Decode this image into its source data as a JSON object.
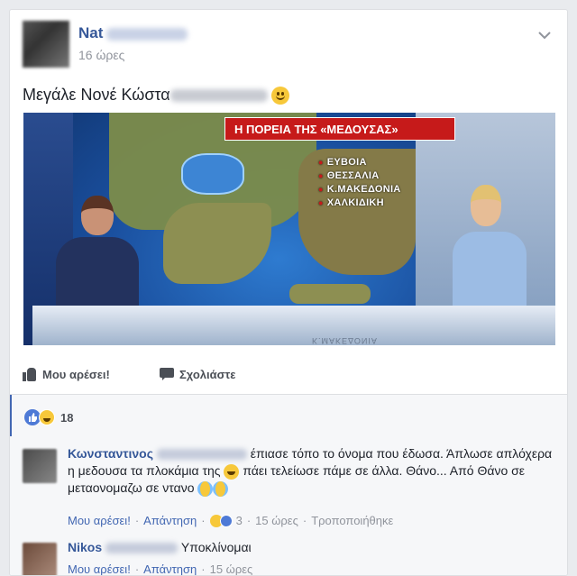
{
  "post": {
    "author_visible": "Nat",
    "timestamp": "16 ώρες",
    "text_visible": "Μεγάλε Νονέ Κώστα",
    "image": {
      "banner": "Η ΠΟΡΕΙΑ ΤΗΣ «ΜΕΔΟΥΣΑΣ»",
      "regions": [
        "ΕΥΒΟΙΑ",
        "ΘΕΣΣΑΛΙΑ",
        "Κ.ΜΑΚΕΔΟΝΙΑ",
        "ΧΑΛΚΙΔΙΚΗ"
      ],
      "desk_text": "Κ.ΜΑΚΕΔΟΝΙΑ"
    }
  },
  "actions": {
    "like_label": "Μου αρέσει!",
    "comment_label": "Σχολιάστε"
  },
  "reactions": {
    "types": [
      "like",
      "haha"
    ],
    "count": "18"
  },
  "comments": [
    {
      "name_visible": "Κωνσταντινος",
      "text_part1": "έπιασε τόπο το όνομα που έδωσα. Άπλωσε απλόχερα η μεδουσα τα πλοκάμια της",
      "text_part2": "πάει τελείωσε πάμε σε άλλα. Θάνο... Από Θάνο σε μεταονομαζω σε ντανο",
      "like_label": "Μου αρέσει!",
      "reply_label": "Απάντηση",
      "reaction_count": "3",
      "time": "15 ώρες",
      "edited_label": "Τροποποιήθηκε"
    },
    {
      "name_visible": "Nikos",
      "text": "Υποκλίνομαι",
      "like_label": "Μου αρέσει!",
      "reply_label": "Απάντηση",
      "time": "15 ώρες"
    }
  ],
  "colors": {
    "link_blue": "#365899",
    "banner_red": "#c61a1a",
    "like_blue": "#4e7ad6"
  }
}
